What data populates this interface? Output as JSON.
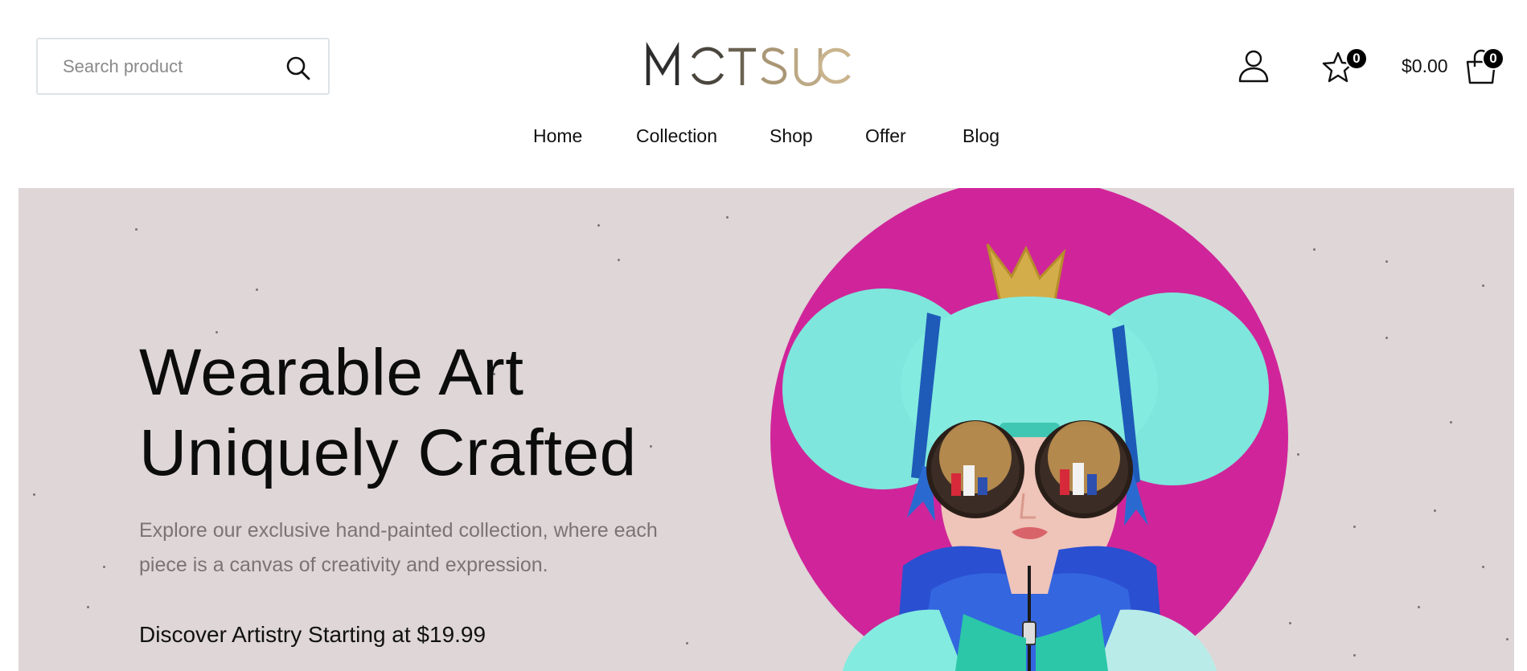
{
  "header": {
    "search": {
      "placeholder": "Search product",
      "value": "",
      "icon": "search-icon"
    },
    "logo": {
      "text": "MOTSUC",
      "colors": {
        "dark": "#2d2d2d",
        "gold": "#c9b48e"
      }
    },
    "account": {
      "icon": "user-icon"
    },
    "wishlist": {
      "icon": "star-icon",
      "count": "0"
    },
    "cart": {
      "icon": "shopping-bag-icon",
      "total": "$0.00",
      "count": "0"
    }
  },
  "nav": {
    "items": [
      {
        "label": "Home"
      },
      {
        "label": "Collection"
      },
      {
        "label": "Shop"
      },
      {
        "label": "Offer"
      },
      {
        "label": "Blog"
      }
    ]
  },
  "hero": {
    "title_line1": "Wearable Art",
    "title_line2": "Uniquely Crafted",
    "subtitle": "Explore our exclusive hand-painted collection, where each piece is a canvas of creativity and expression.",
    "offer": "Discover Artistry Starting at $19.99",
    "colors": {
      "background": "#ded6d7",
      "circle": "#d0259a",
      "hair": "#7ee6dc",
      "jacket": "#2a4fd1"
    }
  }
}
